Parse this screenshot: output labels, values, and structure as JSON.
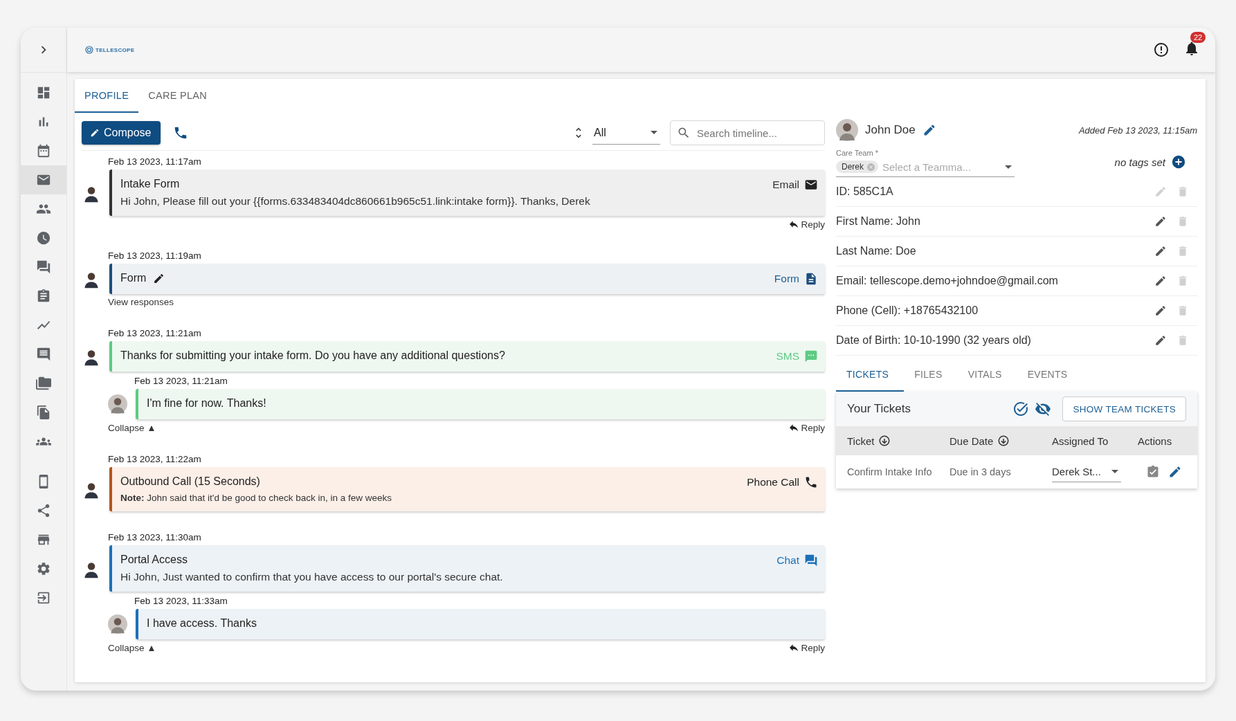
{
  "sidebar": {
    "items": [
      {
        "kind": "dashboard",
        "selected": false
      },
      {
        "kind": "bar_chart",
        "selected": false
      },
      {
        "kind": "calendar",
        "selected": false
      },
      {
        "kind": "mail",
        "selected": true
      },
      {
        "kind": "people",
        "selected": false
      },
      {
        "kind": "clock",
        "selected": false
      },
      {
        "kind": "forum",
        "selected": false
      },
      {
        "kind": "clipboard",
        "selected": false
      },
      {
        "kind": "trend",
        "selected": false
      },
      {
        "kind": "comment",
        "selected": false
      },
      {
        "kind": "folders",
        "selected": false
      },
      {
        "kind": "files",
        "selected": false
      },
      {
        "kind": "groups",
        "selected": false
      }
    ],
    "bottom_items": [
      {
        "kind": "device",
        "selected": false
      },
      {
        "kind": "share",
        "selected": false
      },
      {
        "kind": "store",
        "selected": false
      },
      {
        "kind": "settings",
        "selected": false
      },
      {
        "kind": "logout",
        "selected": false
      }
    ]
  },
  "topbar": {
    "logo": "TELLESCOPE",
    "notification_count": "22"
  },
  "tabs": [
    {
      "label": "PROFILE",
      "selected": true
    },
    {
      "label": "CARE PLAN",
      "selected": false
    }
  ],
  "toolbar": {
    "compose": "Compose",
    "filter": "All",
    "search_placeholder": "Search timeline..."
  },
  "timeline": [
    {
      "time": "Feb 13 2023, 11:17am",
      "kind": "email",
      "title": "Intake Form",
      "title_editable": false,
      "body": "Hi John, Please fill out your {{forms.633483404dc860661b965c51.link:intake form}}. Thanks, Derek",
      "channel": "Email",
      "links": [
        {
          "kind": "reply",
          "label": "Reply"
        }
      ]
    },
    {
      "time": "Feb 13 2023, 11:19am",
      "kind": "form",
      "title": "Form",
      "title_editable": true,
      "channel": "Form",
      "links": [
        {
          "kind": "view",
          "label": "View responses"
        }
      ]
    },
    {
      "time": "Feb 13 2023, 11:21am",
      "kind": "sms",
      "title": "Thanks for submitting your intake form. Do you have any additional questions?",
      "title_editable": false,
      "channel": "SMS",
      "replies": [
        {
          "time": "Feb 13 2023, 11:21am",
          "text": "I'm fine for now. Thanks!"
        }
      ],
      "links": [
        {
          "kind": "collapse",
          "label": "Collapse ▲"
        },
        {
          "kind": "reply",
          "label": "Reply"
        }
      ]
    },
    {
      "time": "Feb 13 2023, 11:22am",
      "kind": "call",
      "title": "Outbound Call (15 Seconds)",
      "title_editable": false,
      "body": "**Note:** John said that it'd be good to check back in, in a few weeks",
      "channel": "Phone Call"
    },
    {
      "time": "Feb 13 2023, 11:30am",
      "kind": "chat",
      "title": "Portal Access",
      "title_editable": false,
      "body": "Hi John, Just wanted to confirm that you have access to our portal's secure chat.",
      "channel": "Chat",
      "replies": [
        {
          "time": "Feb 13 2023, 11:33am",
          "text": "I have access. Thanks"
        }
      ],
      "links": [
        {
          "kind": "collapse",
          "label": "Collapse ▲"
        },
        {
          "kind": "reply",
          "label": "Reply"
        }
      ]
    }
  ],
  "patient": {
    "name": "John Doe",
    "added": "Added Feb 13 2023, 11:15am",
    "care_team_label": "Care Team *",
    "care_team_chip": "Derek",
    "care_team_placeholder": "Select a Teamma...",
    "tags": "no tags set"
  },
  "fields": [
    {
      "text": "ID: 585C1A",
      "editable": false,
      "deletable": false
    },
    {
      "text": "First Name: John",
      "editable": true,
      "deletable": false
    },
    {
      "text": "Last Name: Doe",
      "editable": true,
      "deletable": false
    },
    {
      "text": "Email: tellescope.demo+johndoe@gmail.com",
      "editable": true,
      "deletable": false
    },
    {
      "text": "Phone (Cell): +18765432100",
      "editable": true,
      "deletable": false
    },
    {
      "text": "Date of Birth: 10-10-1990 (32 years old)",
      "editable": true,
      "deletable": false
    }
  ],
  "detail_tabs": [
    {
      "label": "TICKETS",
      "selected": true
    },
    {
      "label": "FILES",
      "selected": false
    },
    {
      "label": "VITALS",
      "selected": false
    },
    {
      "label": "EVENTS",
      "selected": false
    }
  ],
  "tickets": {
    "title": "Your Tickets",
    "button": "SHOW TEAM TICKETS",
    "columns": [
      {
        "label": "Ticket",
        "sortable": true
      },
      {
        "label": "Due Date",
        "sortable": true
      },
      {
        "label": "Assigned To",
        "sortable": false
      },
      {
        "label": "Actions",
        "sortable": false
      }
    ],
    "rows": [
      {
        "ticket": "Confirm Intake Info",
        "due": "Due in 3 days",
        "assignee": "Derek St..."
      }
    ]
  }
}
